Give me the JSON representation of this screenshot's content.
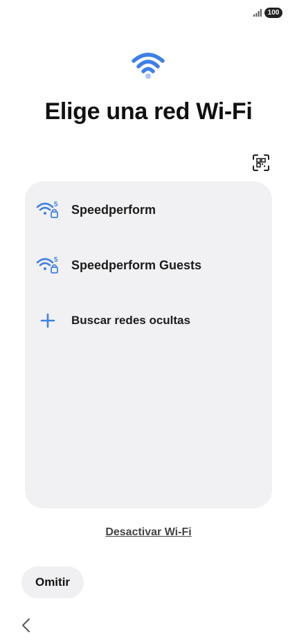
{
  "status_bar": {
    "battery": "100",
    "signal_icon": "signal-bars-icon"
  },
  "page": {
    "title": "Elige una red Wi-Fi",
    "hero_icon": "wifi-icon"
  },
  "qr": {
    "icon": "qr-scan-icon"
  },
  "networks": [
    {
      "name": "Speedperform",
      "band": "5",
      "icon": "wifi-5ghz-lock-icon"
    },
    {
      "name": "Speedperform Guests",
      "band": "5",
      "icon": "wifi-5ghz-lock-icon"
    }
  ],
  "hidden_networks": {
    "label": "Buscar redes ocultas",
    "icon": "plus-icon"
  },
  "footer": {
    "deactivate_label": "Desactivar Wi-Fi",
    "skip_label": "Omitir",
    "back_icon": "chevron-left-icon"
  },
  "colors": {
    "accent": "#3f80e6",
    "accent_light": "#a9c6f5",
    "card_bg": "#f1f1f3",
    "button_bg": "#f0f0f2"
  }
}
